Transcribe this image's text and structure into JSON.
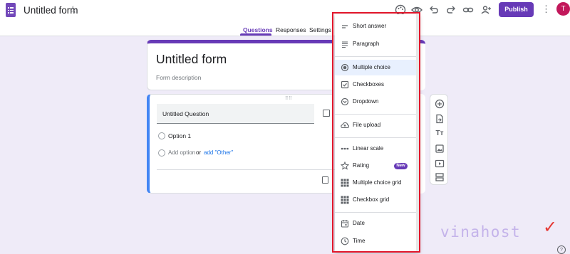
{
  "header": {
    "form_title": "Untitled form",
    "publish_label": "Publish",
    "avatar_initial": "T",
    "tabs": [
      "Questions",
      "Responses",
      "Settings"
    ]
  },
  "title_card": {
    "title": "Untitled form",
    "description_placeholder": "Form description"
  },
  "question_card": {
    "question_text": "Untitled Question",
    "option_1": "Option 1",
    "add_option": "Add option",
    "or_text": "or",
    "add_other": "add \"Other\""
  },
  "menu": {
    "items": [
      {
        "label": "Short answer",
        "icon": "short-text-icon"
      },
      {
        "label": "Paragraph",
        "icon": "paragraph-icon"
      },
      {
        "label": "Multiple choice",
        "icon": "radio-button-icon",
        "selected": true
      },
      {
        "label": "Checkboxes",
        "icon": "checkbox-icon"
      },
      {
        "label": "Dropdown",
        "icon": "dropdown-icon"
      },
      {
        "label": "File upload",
        "icon": "cloud-upload-icon"
      },
      {
        "label": "Linear scale",
        "icon": "linear-scale-icon"
      },
      {
        "label": "Rating",
        "icon": "star-icon",
        "badge": "New"
      },
      {
        "label": "Multiple choice grid",
        "icon": "grid-icon"
      },
      {
        "label": "Checkbox grid",
        "icon": "checkbox-grid-icon"
      },
      {
        "label": "Date",
        "icon": "calendar-icon"
      },
      {
        "label": "Time",
        "icon": "clock-icon"
      }
    ]
  },
  "watermark": "vinahost",
  "colors": {
    "accent": "#673ab7",
    "highlight_border": "#e3162b",
    "question_border": "#4285f4",
    "link": "#1a73e8"
  }
}
